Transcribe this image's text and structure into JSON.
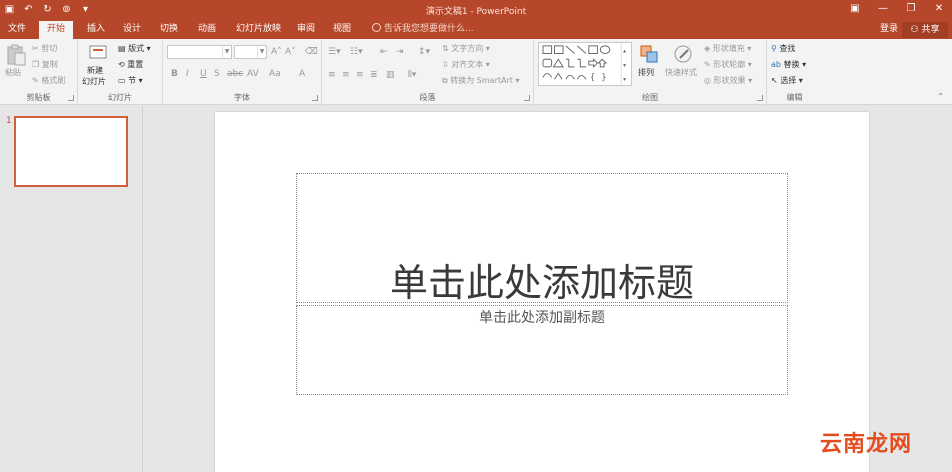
{
  "titlebar": {
    "title": "演示文稿1 - PowerPoint",
    "qat": [
      "save-icon",
      "undo-icon",
      "redo-icon",
      "presentation-icon",
      "customize-icon"
    ],
    "window_buttons": [
      "ribbon-display-icon",
      "minimize-icon",
      "restore-icon",
      "close-icon"
    ]
  },
  "tabs": [
    "文件",
    "开始",
    "插入",
    "设计",
    "切换",
    "动画",
    "幻灯片放映",
    "审阅",
    "视图"
  ],
  "active_tab": "开始",
  "tell_me": "告诉我您想要做什么...",
  "login": "登录",
  "share": "共享",
  "ribbon": {
    "clipboard": {
      "label": "剪贴板",
      "paste": "粘贴",
      "cut": "剪切",
      "copy": "复制",
      "format_painter": "格式刷"
    },
    "slides": {
      "label": "幻灯片",
      "new_slide_1": "新建",
      "new_slide_2": "幻灯片",
      "layout": "版式",
      "reset": "重置",
      "section": "节"
    },
    "font": {
      "label": "字体",
      "bold": "B",
      "italic": "I",
      "underline": "U",
      "shadow": "S",
      "strike": "abc",
      "spacing": "AV",
      "case": "Aa",
      "color": "A",
      "grow": "A",
      "shrink": "A"
    },
    "paragraph": {
      "label": "段落",
      "text_direction": "文字方向",
      "align_text": "对齐文本",
      "smartart": "转换为 SmartArt"
    },
    "drawing": {
      "label": "绘图",
      "arrange": "排列",
      "quick_styles": "快速样式",
      "shape_fill": "形状填充",
      "shape_outline": "形状轮廓",
      "shape_effects": "形状效果"
    },
    "editing": {
      "label": "编辑",
      "find": "查找",
      "replace": "替换",
      "select": "选择"
    }
  },
  "thumbnail": {
    "number": "1"
  },
  "slide": {
    "title_placeholder": "单击此处添加标题",
    "subtitle_placeholder": "单击此处添加副标题"
  },
  "watermark": "云南龙网",
  "colors": {
    "accent": "#b7472a",
    "thumb_border": "#d0603b"
  }
}
